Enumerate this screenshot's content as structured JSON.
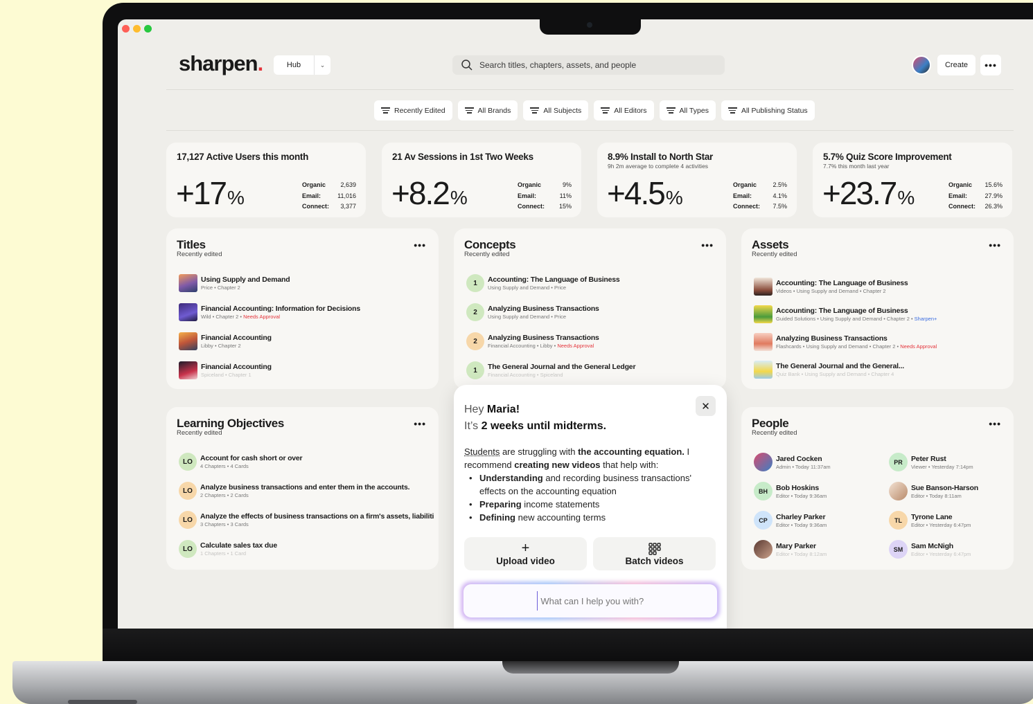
{
  "brand": {
    "name": "sharpen",
    "dot": "."
  },
  "header": {
    "hub_label": "Hub",
    "search_placeholder": "Search titles, chapters, assets, and people",
    "create_label": "Create",
    "more": "•••"
  },
  "filters": [
    "Recently Edited",
    "All Brands",
    "All Subjects",
    "All Editors",
    "All Types",
    "All Publishing Status"
  ],
  "stats": [
    {
      "title": "17,127 Active Users this month",
      "subtitle": "",
      "value": "+17",
      "unit": "%",
      "rows": [
        {
          "k": "Organic",
          "v": "2,639"
        },
        {
          "k": "Email:",
          "v": "11,016"
        },
        {
          "k": "Connect:",
          "v": "3,377"
        }
      ]
    },
    {
      "title": "21 Av Sessions in 1st Two Weeks",
      "subtitle": "",
      "value": "+8.2",
      "unit": "%",
      "rows": [
        {
          "k": "Organic",
          "v": "9%"
        },
        {
          "k": "Email:",
          "v": "11%"
        },
        {
          "k": "Connect:",
          "v": "15%"
        }
      ]
    },
    {
      "title": "8.9% Install to North Star",
      "subtitle": "9h 2m average to complete 4 activities",
      "value": "+4.5",
      "unit": "%",
      "rows": [
        {
          "k": "Organic",
          "v": "2.5%"
        },
        {
          "k": "Email:",
          "v": "4.1%"
        },
        {
          "k": "Connect:",
          "v": "7.5%"
        }
      ]
    },
    {
      "title": "5.7% Quiz Score Improvement",
      "subtitle": "7.7% this month last year",
      "value": "+23.7",
      "unit": "%",
      "rows": [
        {
          "k": "Organic",
          "v": "15.6%"
        },
        {
          "k": "Email:",
          "v": "27.9%"
        },
        {
          "k": "Connect:",
          "v": "26.3%"
        }
      ]
    }
  ],
  "titles": {
    "heading": "Titles",
    "sub": "Recently edited",
    "items": [
      {
        "title": "Using Supply and Demand",
        "meta": "Price • Chapter 2",
        "alert": ""
      },
      {
        "title": "Financial Accounting: Information for Decisions",
        "meta": "Wild • Chapter 2 • ",
        "alert": "Needs Approval"
      },
      {
        "title": "Financial Accounting",
        "meta": "Libby • Chapter 2",
        "alert": ""
      },
      {
        "title": "Financial Accounting",
        "meta": "Spiceland • Chapter 1",
        "alert": ""
      }
    ]
  },
  "concepts": {
    "heading": "Concepts",
    "sub": "Recently edited",
    "items": [
      {
        "num": "1",
        "title": "Accounting: The Language of Business",
        "meta": "Using Supply and Demand • Price",
        "alert": ""
      },
      {
        "num": "2",
        "title": "Analyzing Business Transactions",
        "meta": "Using Supply and Demand • Price",
        "alert": ""
      },
      {
        "num": "2",
        "title": "Analyzing Business Transactions",
        "meta": "Financial Accounting • Libby • ",
        "alert": "Needs Approval"
      },
      {
        "num": "1",
        "title": "The General Journal and the General Ledger",
        "meta": "Financial Accounting • Spiceland",
        "alert": ""
      }
    ]
  },
  "assets": {
    "heading": "Assets",
    "sub": "Recently edited",
    "items": [
      {
        "title": "Accounting: The Language of Business",
        "meta": "Videos • Using Supply and Demand • Chapter 2",
        "tag": ""
      },
      {
        "title": "Accounting: The Language of Business",
        "meta": "Guided Solutions • Using Supply and Demand • Chapter 2 • ",
        "tag": "Sharpen+"
      },
      {
        "title": "Analyzing Business Transactions",
        "meta": "Flashcards • Using Supply and Demand • Chapter 2 • ",
        "tag": "Needs Approval"
      },
      {
        "title": "The General Journal and the General...",
        "meta": "Quiz Bank • Using Supply and Demand • Chapter 4",
        "tag": ""
      }
    ]
  },
  "objectives": {
    "heading": "Learning Objectives",
    "sub": "Recently edited",
    "items": [
      {
        "badge": "LO",
        "title": "Account for cash short or over",
        "meta": "4 Chapters • 4 Cards"
      },
      {
        "badge": "LO",
        "title": "Analyze business transactions and enter them in the accounts.",
        "meta": "2 Chapters • 2 Cards"
      },
      {
        "badge": "LO",
        "title": "Analyze the effects of business transactions on a firm's assets, liabiliti",
        "meta": "3 Chapters • 3 Cards"
      },
      {
        "badge": "LO",
        "title": "Calculate sales tax due",
        "meta": "1 Chapters • 1 Card"
      }
    ]
  },
  "people": {
    "heading": "People",
    "sub": "Recently edited",
    "items": [
      {
        "initials": "",
        "name": "Jared Cocken",
        "meta": "Admin • Today 11:37am"
      },
      {
        "initials": "PR",
        "name": "Peter Rust",
        "meta": "Viewer • Yesterday 7:14pm"
      },
      {
        "initials": "BH",
        "name": "Bob Hoskins",
        "meta": "Editor • Today 9:36am"
      },
      {
        "initials": "",
        "name": "Sue Banson-Harson",
        "meta": "Editor • Today 8:11am"
      },
      {
        "initials": "CP",
        "name": "Charley Parker",
        "meta": "Editor • Today 9:36am"
      },
      {
        "initials": "TL",
        "name": "Tyrone Lane",
        "meta": "Editor • Yesterday 6:47pm"
      },
      {
        "initials": "",
        "name": "Mary Parker",
        "meta": "Editor • Today 8:12am"
      },
      {
        "initials": "SM",
        "name": "Sam McNigh",
        "meta": "Editor • Yesterday 6:47pm"
      }
    ]
  },
  "assistant": {
    "greet_hey": "Hey ",
    "greet_name": "Maria!",
    "line2_pre": "It’s ",
    "line2_bold": "2 weeks until midterms.",
    "msg_a": "Students",
    "msg_b": " are struggling with ",
    "msg_c": "the accounting equation.",
    "msg_d": " I recommend ",
    "msg_e": "creating new videos",
    "msg_f": " that help with:",
    "bullets": [
      {
        "bold": "Understanding",
        "rest": " and recording business transactions' effects on the accounting equation"
      },
      {
        "bold": "Preparing",
        "rest": " income statements"
      },
      {
        "bold": "Defining",
        "rest": " new accounting terms"
      }
    ],
    "upload_label": "Upload video",
    "batch_label": "Batch videos",
    "prompt_placeholder": "What can I help you with?",
    "close": "✕"
  },
  "colors": {
    "background": "#fdfbd3",
    "screen": "#efeeea",
    "card": "#f8f7f4",
    "alert": "#e4343b",
    "accent": "#3d6ee0",
    "badge_green": "#cfe8bf",
    "badge_orange": "#f7d7a9"
  }
}
